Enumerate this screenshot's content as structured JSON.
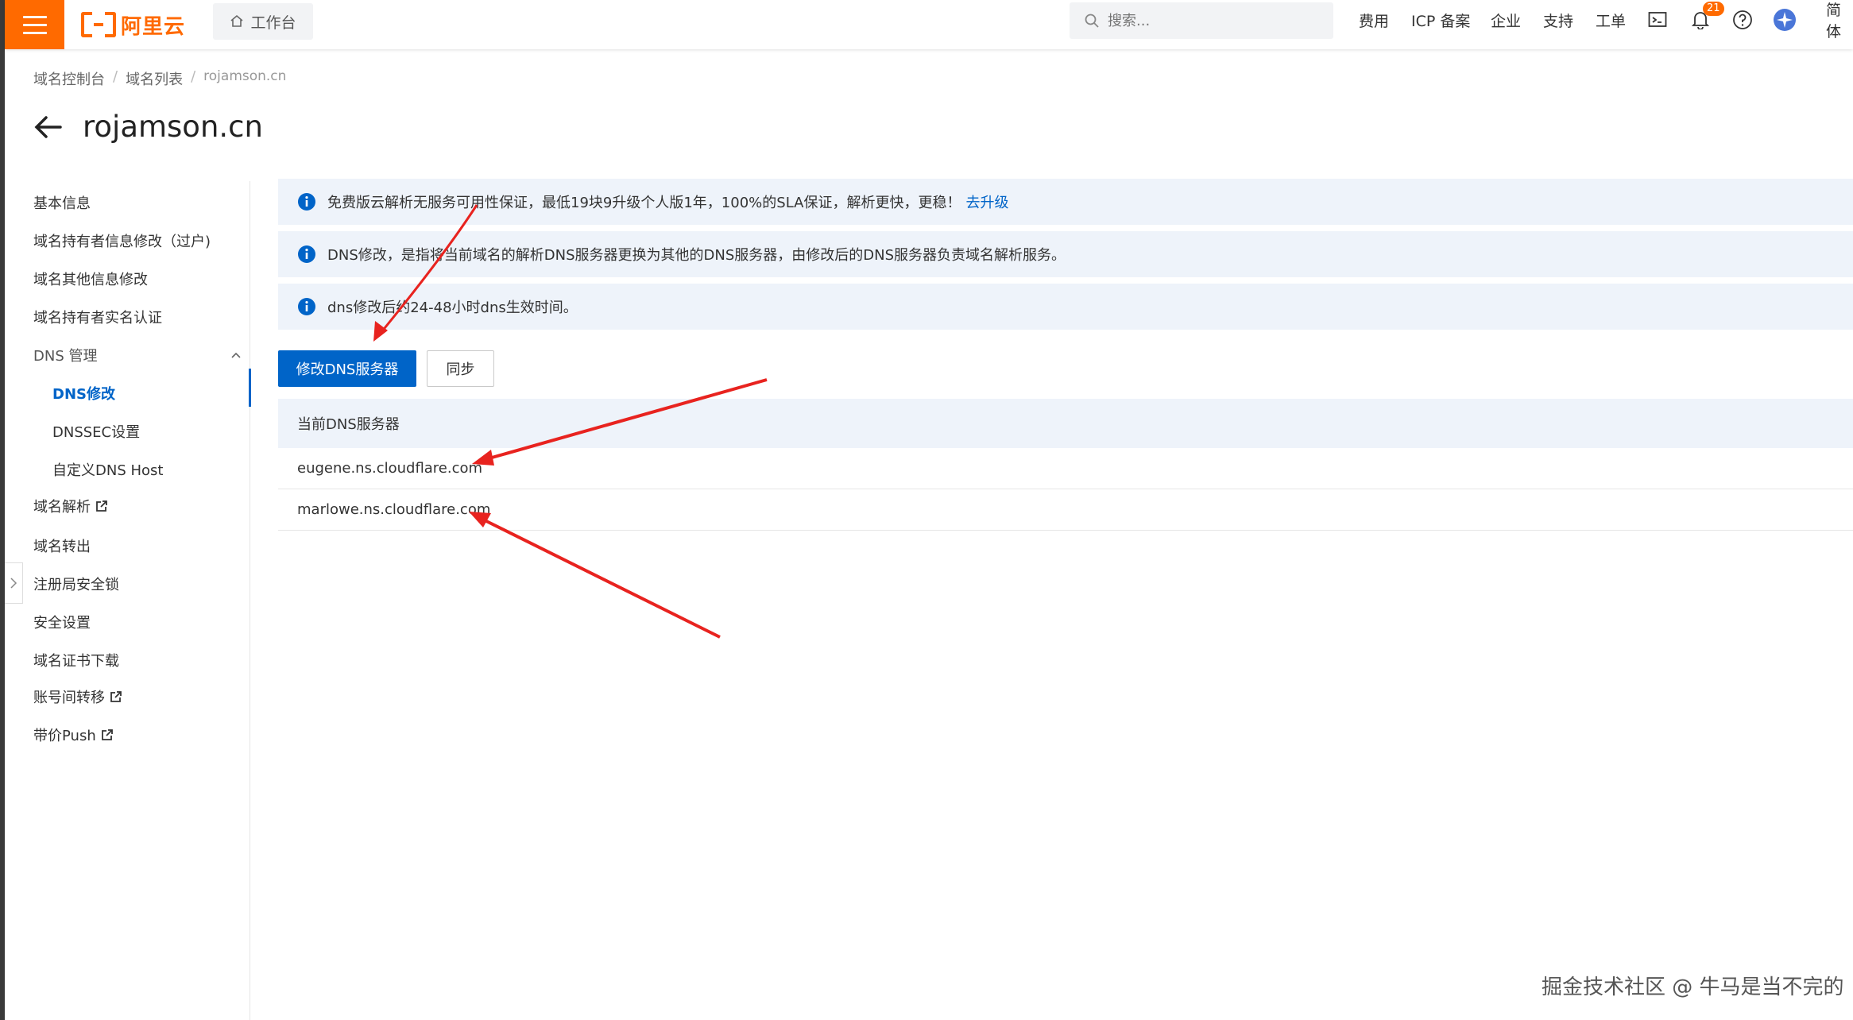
{
  "header": {
    "logo_text": "阿里云",
    "workbench_label": "工作台",
    "search_placeholder": "搜索...",
    "nav": [
      "费用",
      "ICP 备案",
      "企业",
      "支持",
      "工单"
    ],
    "notification_count": "21",
    "language": "简体"
  },
  "breadcrumb": [
    "域名控制台",
    "域名列表",
    "rojamson.cn"
  ],
  "page_title": "rojamson.cn",
  "sidebar": {
    "items": [
      {
        "label": "基本信息"
      },
      {
        "label": "域名持有者信息修改（过户)"
      },
      {
        "label": "域名其他信息修改"
      },
      {
        "label": "域名持有者实名认证"
      },
      {
        "label": "DNS 管理"
      },
      {
        "label": "DNS修改"
      },
      {
        "label": "DNSSEC设置"
      },
      {
        "label": "自定义DNS Host"
      },
      {
        "label": "域名解析"
      },
      {
        "label": "域名转出"
      },
      {
        "label": "注册局安全锁"
      },
      {
        "label": "安全设置"
      },
      {
        "label": "域名证书下载"
      },
      {
        "label": "账号间转移"
      },
      {
        "label": "带价Push"
      }
    ]
  },
  "notices": [
    {
      "text": "免费版云解析无服务可用性保证，最低19块9升级个人版1年，100%的SLA保证，解析更快，更稳！",
      "link": "去升级"
    },
    {
      "text": "DNS修改，是指将当前域名的解析DNS服务器更换为其他的DNS服务器，由修改后的DNS服务器负责域名解析服务。"
    },
    {
      "text": "dns修改后约24-48小时dns生效时间。"
    }
  ],
  "buttons": {
    "modify": "修改DNS服务器",
    "sync": "同步"
  },
  "dns_table": {
    "header": "当前DNS服务器",
    "rows": [
      "eugene.ns.cloudflare.com",
      "marlowe.ns.cloudflare.com"
    ]
  },
  "watermark": "掘金技术社区 @ 牛马是当不完的",
  "colors": {
    "brand": "#ff6a00",
    "primary": "#0064c8",
    "annotation_arrow": "#e8231f"
  }
}
